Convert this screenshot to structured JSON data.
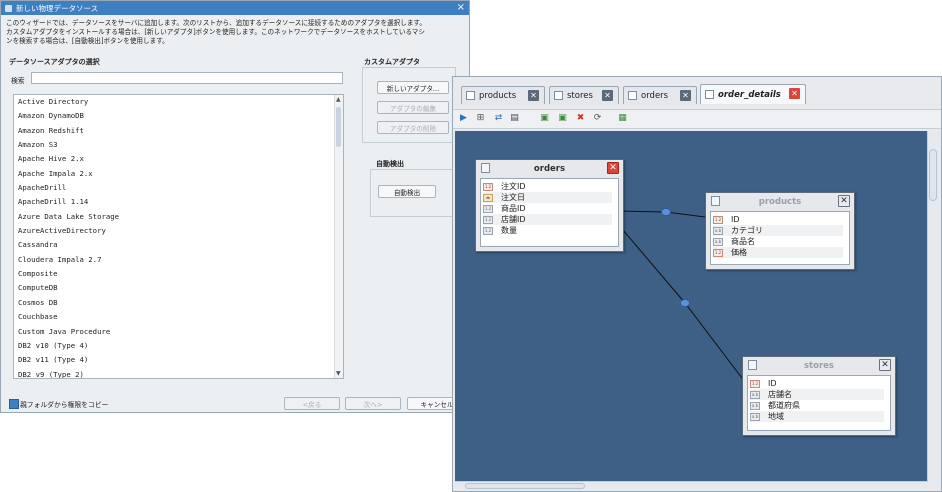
{
  "wizard": {
    "title": "新しい物理データソース",
    "description": [
      "このウィザードでは、データソースをサーバに追加します。次のリストから、追加するデータソースに接続するためのアダプタを選択します。",
      "カスタムアダプタをインストールする場合は、[新しいアダプタ]ボタンを使用します。このネットワークでデータソースをホストしているマシ",
      "ンを検索する場合は、[自動検出]ボタンを使用します。"
    ],
    "adapter_section_title": "データソースアダプタの選択",
    "search_label": "検索",
    "search_value": "",
    "adapters": [
      "Active Directory",
      "Amazon DynamoDB",
      "Amazon Redshift",
      "Amazon S3",
      "Apache Hive 2.x",
      "Apache Impala 2.x",
      "ApacheDrill",
      "ApacheDrill 1.14",
      "Azure Data Lake Storage",
      "AzureActiveDirectory",
      "Cassandra",
      "Cloudera Impala 2.7",
      "Composite",
      "ComputeDB",
      "Cosmos DB",
      "Couchbase",
      "Custom Java Procedure",
      "DB2 v10 (Type 4)",
      "DB2 v11 (Type 4)",
      "DB2 v9 (Type 2)"
    ],
    "custom_section_title": "カスタムアダプタ",
    "new_adapter_label": "新しいアダプタ...",
    "edit_adapter_label": "アダプタの編集",
    "delete_adapter_label": "アダプタの削除",
    "autodetect_section_title": "自動検出",
    "autodetect_label": "自動検出",
    "copy_privileges_label": "親フォルダから権限をコピー",
    "back_label": "<戻る",
    "next_label": "次へ>",
    "cancel_label": "キャンセル"
  },
  "editor": {
    "tabs": [
      {
        "label": "products",
        "active": false
      },
      {
        "label": "stores",
        "active": false
      },
      {
        "label": "orders",
        "active": false
      },
      {
        "label": "order_details",
        "active": true
      }
    ],
    "tables": {
      "orders": {
        "title": "orders",
        "fields": [
          "注文ID",
          "注文日",
          "商品ID",
          "店舗ID",
          "数量"
        ]
      },
      "products": {
        "title": "products",
        "fields": [
          "ID",
          "カテゴリ",
          "商品名",
          "価格"
        ]
      },
      "stores": {
        "title": "stores",
        "fields": [
          "ID",
          "店舗名",
          "都道府県",
          "地域"
        ]
      }
    },
    "canvas_color": "#3e6086"
  }
}
